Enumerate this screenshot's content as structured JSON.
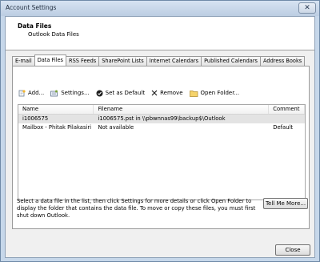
{
  "window": {
    "title": "Account Settings",
    "close_glyph": "✕"
  },
  "header": {
    "title": "Data Files",
    "subtitle": "Outlook Data Files"
  },
  "tabs": [
    {
      "label": "E-mail"
    },
    {
      "label": "Data Files"
    },
    {
      "label": "RSS Feeds"
    },
    {
      "label": "SharePoint Lists"
    },
    {
      "label": "Internet Calendars"
    },
    {
      "label": "Published Calendars"
    },
    {
      "label": "Address Books"
    }
  ],
  "toolbar": {
    "add": "Add...",
    "settings": "Settings...",
    "set_default": "Set as Default",
    "remove": "Remove",
    "open_folder": "Open Folder..."
  },
  "list": {
    "columns": [
      "Name",
      "Filename",
      "Comment"
    ],
    "rows": [
      {
        "name": "i1006575",
        "filename": "i1006575.pst in \\\\pbwnnas99\\backup$\\Outlook",
        "comment": ""
      },
      {
        "name": "Mailbox - Phitak Pilakasiri",
        "filename": "Not available",
        "comment": "Default"
      }
    ]
  },
  "description": "Select a data file in the list, then click Settings for more details or click Open Folder to display the folder that contains the data file. To move or copy these files, you must first shut down Outlook.",
  "buttons": {
    "tell_me_more": "Tell Me More...",
    "close": "Close"
  }
}
